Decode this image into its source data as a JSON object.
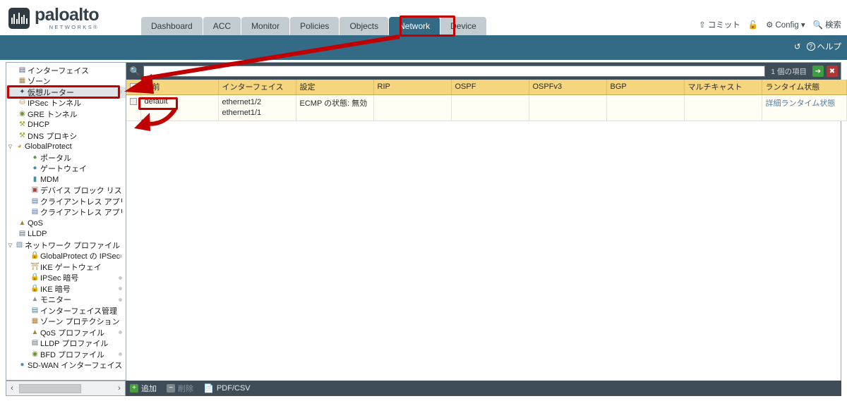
{
  "brand": {
    "name": "paloalto",
    "sub": "NETWORKS®"
  },
  "tabs": [
    {
      "label": "Dashboard",
      "active": false
    },
    {
      "label": "ACC",
      "active": false
    },
    {
      "label": "Monitor",
      "active": false
    },
    {
      "label": "Policies",
      "active": false
    },
    {
      "label": "Objects",
      "active": false
    },
    {
      "label": "Network",
      "active": true
    },
    {
      "label": "Device",
      "active": false
    }
  ],
  "topright": [
    {
      "icon": "commit-icon",
      "glyph": "⇧",
      "label": "コミット"
    },
    {
      "icon": "lock-icon",
      "glyph": "🔓",
      "label": ""
    },
    {
      "icon": "config-icon",
      "glyph": "⚙",
      "label": "Config ▾"
    },
    {
      "icon": "search-icon",
      "glyph": "🔍",
      "label": "検索"
    }
  ],
  "band": [
    {
      "icon": "refresh-icon",
      "glyph": "↺",
      "label": ""
    },
    {
      "icon": "help-icon",
      "glyph": "?",
      "label": "ヘルプ"
    }
  ],
  "sidebar": {
    "items": [
      {
        "label": "インターフェイス",
        "icon": "interface-icon",
        "glyph": "▤",
        "color": "#4a5a66",
        "indent": 1,
        "twisty": "",
        "selected": false,
        "dot": false
      },
      {
        "label": "ゾーン",
        "icon": "zone-icon",
        "glyph": "▦",
        "color": "#b07b3a",
        "indent": 1,
        "twisty": "",
        "selected": false,
        "dot": false
      },
      {
        "label": "仮想ルーター",
        "icon": "virtual-router-icon",
        "glyph": "✦",
        "color": "#3a4a58",
        "indent": 1,
        "twisty": "",
        "selected": true,
        "dot": true
      },
      {
        "label": "IPSec トンネル",
        "icon": "ipsec-tunnel-icon",
        "glyph": "⛁",
        "color": "#c08a3e",
        "indent": 1,
        "twisty": "",
        "selected": false,
        "dot": false
      },
      {
        "label": "GRE トンネル",
        "icon": "gre-tunnel-icon",
        "glyph": "◉",
        "color": "#6d8f3a",
        "indent": 1,
        "twisty": "",
        "selected": false,
        "dot": false
      },
      {
        "label": "DHCP",
        "icon": "dhcp-icon",
        "glyph": "⚒",
        "color": "#9aa03a",
        "indent": 1,
        "twisty": "",
        "selected": false,
        "dot": false
      },
      {
        "label": "DNS プロキシ",
        "icon": "dns-proxy-icon",
        "glyph": "⚒",
        "color": "#9aa03a",
        "indent": 1,
        "twisty": "",
        "selected": false,
        "dot": false
      },
      {
        "label": "GlobalProtect",
        "icon": "globalprotect-icon",
        "glyph": "◕",
        "color": "#d8a13a",
        "indent": 0,
        "twisty": "▽",
        "selected": false,
        "dot": false
      },
      {
        "label": "ポータル",
        "icon": "portal-icon",
        "glyph": "●",
        "color": "#5a9c4a",
        "indent": 2,
        "twisty": "",
        "selected": false,
        "dot": false
      },
      {
        "label": "ゲートウェイ",
        "icon": "gateway-icon",
        "glyph": "●",
        "color": "#4a8fa8",
        "indent": 2,
        "twisty": "",
        "selected": false,
        "dot": false
      },
      {
        "label": "MDM",
        "icon": "mdm-icon",
        "glyph": "▮",
        "color": "#4a8fa8",
        "indent": 2,
        "twisty": "",
        "selected": false,
        "dot": false
      },
      {
        "label": "デバイス ブロック リスト",
        "icon": "device-block-list-icon",
        "glyph": "▣",
        "color": "#b0423a",
        "indent": 2,
        "twisty": "",
        "selected": false,
        "dot": false
      },
      {
        "label": "クライアントレス アプリケー",
        "icon": "clientless-app-icon",
        "glyph": "▤",
        "color": "#4a6fa8",
        "indent": 2,
        "twisty": "",
        "selected": false,
        "dot": false
      },
      {
        "label": "クライアントレス アプリケー",
        "icon": "clientless-app-group-icon",
        "glyph": "▤",
        "color": "#4a6fa8",
        "indent": 2,
        "twisty": "",
        "selected": false,
        "dot": false
      },
      {
        "label": "QoS",
        "icon": "qos-icon",
        "glyph": "▲",
        "color": "#9a8a3a",
        "indent": 1,
        "twisty": "",
        "selected": false,
        "dot": false
      },
      {
        "label": "LLDP",
        "icon": "lldp-icon",
        "glyph": "▤",
        "color": "#5a6a78",
        "indent": 1,
        "twisty": "",
        "selected": false,
        "dot": false
      },
      {
        "label": "ネットワーク プロファイル",
        "icon": "network-profiles-icon",
        "glyph": "▧",
        "color": "#6a8aa8",
        "indent": 0,
        "twisty": "▽",
        "selected": false,
        "dot": false
      },
      {
        "label": "GlobalProtect の IPSec 暗号",
        "icon": "lock-icon",
        "glyph": "🔒",
        "color": "#d8a13a",
        "indent": 2,
        "twisty": "",
        "selected": false,
        "dot": true
      },
      {
        "label": "IKE ゲートウェイ",
        "icon": "ike-gateway-icon",
        "glyph": "⛩",
        "color": "#b0823a",
        "indent": 2,
        "twisty": "",
        "selected": false,
        "dot": false
      },
      {
        "label": "IPSec 暗号",
        "icon": "lock-icon",
        "glyph": "🔒",
        "color": "#d8a13a",
        "indent": 2,
        "twisty": "",
        "selected": false,
        "dot": true
      },
      {
        "label": "IKE 暗号",
        "icon": "lock-icon",
        "glyph": "🔒",
        "color": "#d8a13a",
        "indent": 2,
        "twisty": "",
        "selected": false,
        "dot": true
      },
      {
        "label": "モニター",
        "icon": "monitor-icon",
        "glyph": "▲",
        "color": "#8a94a0",
        "indent": 2,
        "twisty": "",
        "selected": false,
        "dot": true
      },
      {
        "label": "インターフェイス管理",
        "icon": "interface-mgmt-icon",
        "glyph": "▤",
        "color": "#4a7a9a",
        "indent": 2,
        "twisty": "",
        "selected": false,
        "dot": false
      },
      {
        "label": "ゾーン プロテクション",
        "icon": "zone-protection-icon",
        "glyph": "▦",
        "color": "#b07b3a",
        "indent": 2,
        "twisty": "",
        "selected": false,
        "dot": false
      },
      {
        "label": "QoS プロファイル",
        "icon": "qos-profile-icon",
        "glyph": "▲",
        "color": "#9a8a3a",
        "indent": 2,
        "twisty": "",
        "selected": false,
        "dot": true
      },
      {
        "label": "LLDP プロファイル",
        "icon": "lldp-profile-icon",
        "glyph": "▤",
        "color": "#5a6a78",
        "indent": 2,
        "twisty": "",
        "selected": false,
        "dot": false
      },
      {
        "label": "BFD プロファイル",
        "icon": "bfd-profile-icon",
        "glyph": "◉",
        "color": "#6d8f3a",
        "indent": 2,
        "twisty": "",
        "selected": false,
        "dot": true
      },
      {
        "label": "SD-WAN インターフェイス プロフ",
        "icon": "sdwan-interface-profile-icon",
        "glyph": "●",
        "color": "#4a8fa8",
        "indent": 1,
        "twisty": "",
        "selected": false,
        "dot": false
      }
    ],
    "scroll": {
      "left_arrow": "‹",
      "right_arrow": "›"
    }
  },
  "search": {
    "placeholder": "",
    "value": "",
    "item_count": "1 個の項目",
    "apply_glyph": "➔",
    "clear_glyph": "✖"
  },
  "table": {
    "columns": [
      "名前",
      "インターフェイス",
      "設定",
      "RIP",
      "OSPF",
      "OSPFv3",
      "BGP",
      "マルチキャスト",
      "ランタイム状態"
    ],
    "rows": [
      {
        "name": "default",
        "interfaces": [
          "ethernet1/2",
          "ethernet1/1"
        ],
        "settings": "ECMP の状態: 無効",
        "rip": "",
        "ospf": "",
        "ospfv3": "",
        "bgp": "",
        "multicast": "",
        "runtime_status": "詳細ランタイム状態"
      }
    ]
  },
  "bottom": {
    "add": "追加",
    "delete": "削除",
    "export": "PDF/CSV"
  },
  "colors": {
    "header_teal": "#336b87",
    "tab_inactive": "#c3ccd1",
    "table_header": "#f5d57e",
    "toolbar_dark": "#3f4d59",
    "annotation_red": "#c00000",
    "link_blue": "#4f7fa8"
  }
}
